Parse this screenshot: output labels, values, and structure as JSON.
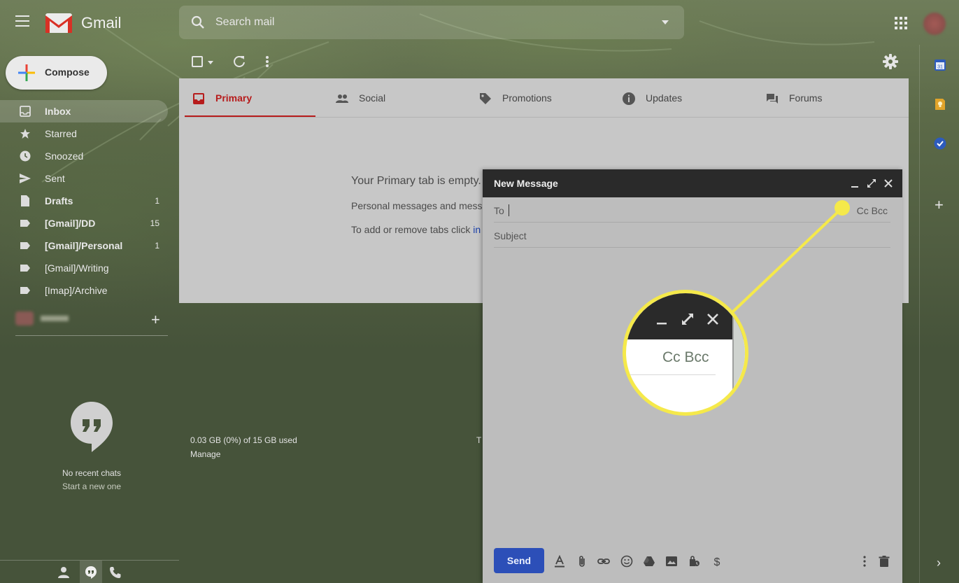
{
  "header": {
    "app_name": "Gmail",
    "search_placeholder": "Search mail"
  },
  "sidebar": {
    "compose_label": "Compose",
    "items": [
      {
        "label": "Inbox",
        "icon": "inbox-icon",
        "bold": true,
        "count": ""
      },
      {
        "label": "Starred",
        "icon": "star-icon",
        "bold": false,
        "count": ""
      },
      {
        "label": "Snoozed",
        "icon": "clock-icon",
        "bold": false,
        "count": ""
      },
      {
        "label": "Sent",
        "icon": "send-icon",
        "bold": false,
        "count": ""
      },
      {
        "label": "Drafts",
        "icon": "draft-icon",
        "bold": true,
        "count": "1"
      },
      {
        "label": "[Gmail]/DD",
        "icon": "label-icon",
        "bold": true,
        "count": "15"
      },
      {
        "label": "[Gmail]/Personal",
        "icon": "label-icon",
        "bold": true,
        "count": "1"
      },
      {
        "label": "[Gmail]/Writing",
        "icon": "label-icon",
        "bold": false,
        "count": ""
      },
      {
        "label": "[Imap]/Archive",
        "icon": "label-icon",
        "bold": false,
        "count": ""
      }
    ],
    "chat": {
      "no_chats": "No recent chats",
      "start_new": "Start a new one"
    }
  },
  "tabs": [
    {
      "label": "Primary",
      "icon": "inbox-tab-icon",
      "active": true
    },
    {
      "label": "Social",
      "icon": "people-icon",
      "active": false
    },
    {
      "label": "Promotions",
      "icon": "tag-icon",
      "active": false
    },
    {
      "label": "Updates",
      "icon": "info-icon",
      "active": false
    },
    {
      "label": "Forums",
      "icon": "forum-icon",
      "active": false
    }
  ],
  "main": {
    "empty_title": "Your Primary tab is empty.",
    "empty_desc": "Personal messages and mess",
    "empty_add_prefix": "To add or remove tabs click ",
    "empty_add_link": "in",
    "storage": "0.03 GB (0%) of 15 GB used",
    "manage": "Manage",
    "footer_peek": "T"
  },
  "compose": {
    "title": "New Message",
    "to_label": "To",
    "cc_bcc": "Cc Bcc",
    "subject_label": "Subject",
    "send_label": "Send"
  },
  "callout": {
    "magnified_text": "Cc Bcc",
    "highlight_color": "#f5e94a"
  },
  "colors": {
    "accent_red": "#b71c1c",
    "send_blue": "#2c4fb8"
  }
}
